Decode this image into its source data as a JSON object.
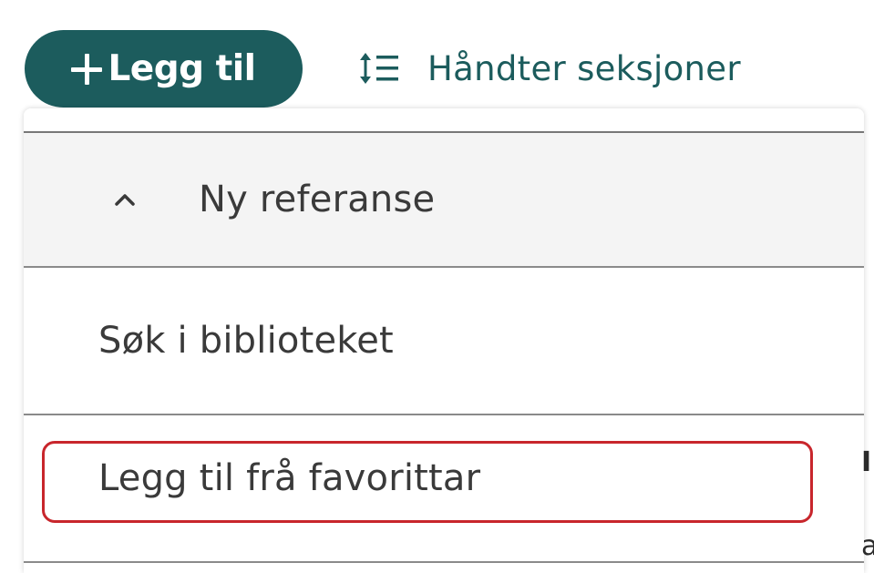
{
  "toolbar": {
    "add_button_label": "Legg til",
    "manage_sections_label": "Håndter seksjoner",
    "accent_color": "#1c5c5d"
  },
  "menu": {
    "header": {
      "label": "Ny referanse",
      "chevron": "chevron-up-icon"
    },
    "items": [
      {
        "label": "Søk i biblioteket"
      },
      {
        "label": "Legg til frå favorittar",
        "highlighted": true,
        "highlight_color": "#c8262c"
      }
    ]
  },
  "edge_fragments": [
    "I",
    "a"
  ]
}
